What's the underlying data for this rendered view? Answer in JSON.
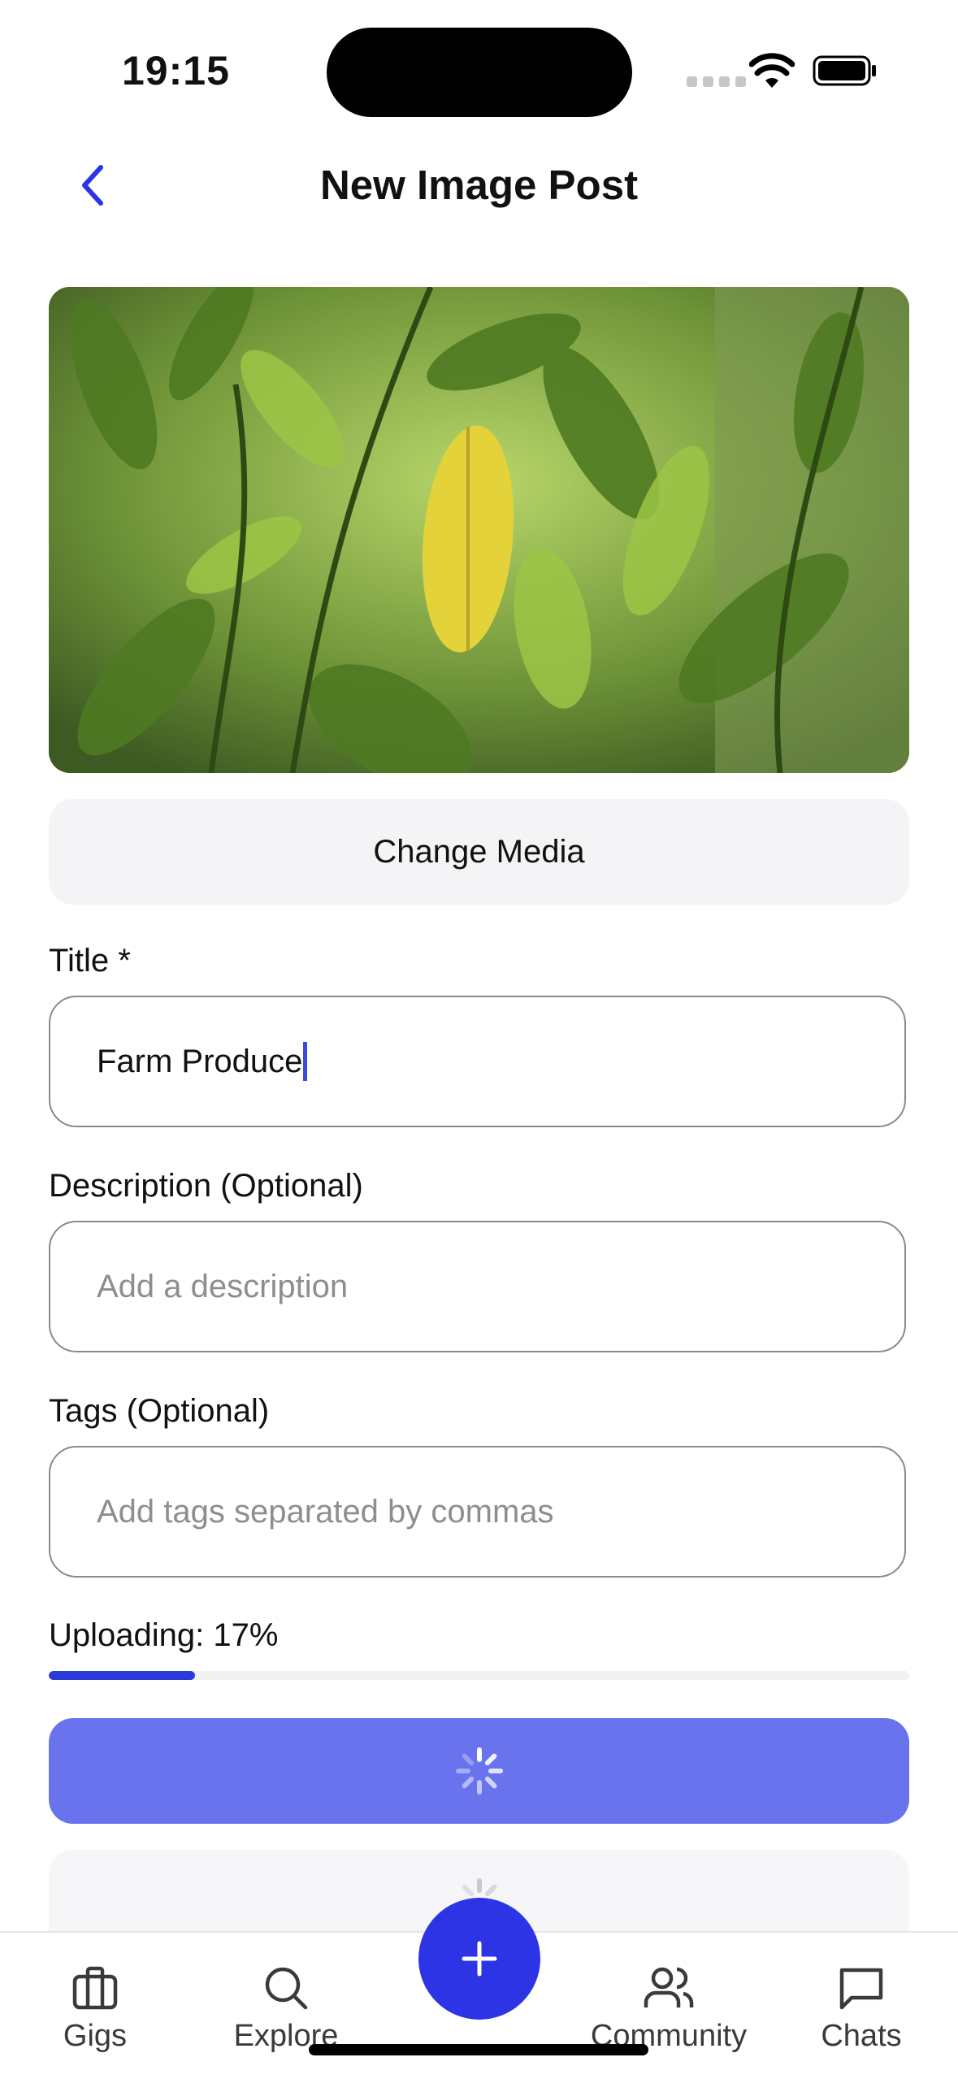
{
  "status_bar": {
    "time": "19:15"
  },
  "nav": {
    "title": "New Image Post",
    "back_icon": "chevron-left-icon"
  },
  "media": {
    "change_label": "Change Media"
  },
  "form": {
    "title_label": "Title *",
    "title_value": "Farm Produce",
    "description_label": "Description (Optional)",
    "description_placeholder": "Add a description",
    "tags_label": "Tags (Optional)",
    "tags_placeholder": "Add tags separated by commas"
  },
  "upload": {
    "label": "Uploading: 17%",
    "progress": 0.17
  },
  "colors": {
    "accent": "#2c34e6",
    "submit_disabled": "#6a73ee",
    "progress": "#2c3bd8"
  },
  "tabbar": {
    "items": [
      {
        "label": "Gigs",
        "icon": "briefcase-icon"
      },
      {
        "label": "Explore",
        "icon": "search-icon"
      },
      {
        "label": "Community",
        "icon": "users-icon"
      },
      {
        "label": "Chats",
        "icon": "chat-bubble-icon"
      }
    ],
    "fab_icon": "plus-icon"
  }
}
